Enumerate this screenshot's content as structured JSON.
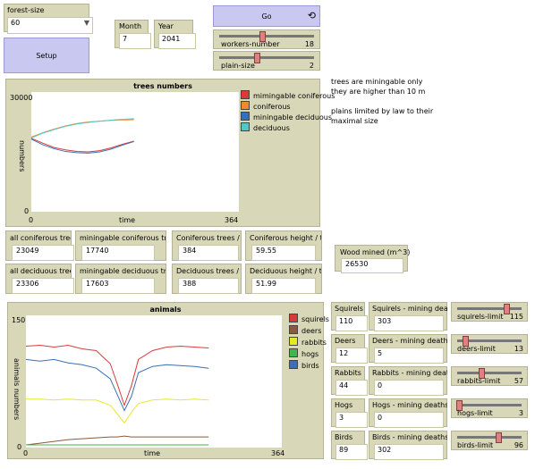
{
  "forest_size": {
    "label": "forest-size",
    "value": "60"
  },
  "month": {
    "label": "Month",
    "value": "7"
  },
  "year": {
    "label": "Year",
    "value": "2041"
  },
  "go_label": "Go",
  "setup_label": "Setup",
  "workers_slider": {
    "label": "workers-number",
    "value": "18",
    "level": 0.45
  },
  "plain_slider": {
    "label": "plain-size",
    "value": "2",
    "level": 0.4
  },
  "notes": [
    "trees are miningable only",
    "they are higher than 10 m",
    "",
    "plains limited by law to their",
    "maximal size"
  ],
  "trees_monitors": {
    "all_coniferous": {
      "label": "all coniferous trees",
      "value": "23049"
    },
    "mining_coniferous": {
      "label": "miningable coniferous trees",
      "value": "17740"
    },
    "coniferous_per_ha": {
      "label": "Coniferous trees / ha",
      "value": "384"
    },
    "coniferous_height": {
      "label": "Coniferous height / tile",
      "value": "59.55"
    },
    "all_deciduous": {
      "label": "all deciduous trees",
      "value": "23306"
    },
    "mining_deciduous": {
      "label": "miningable deciduous trees",
      "value": "17603"
    },
    "deciduous_per_ha": {
      "label": "Deciduous trees / ha",
      "value": "388"
    },
    "deciduous_height": {
      "label": "Deciduous height / tile",
      "value": "51.99"
    }
  },
  "wood_mined": {
    "label": "Wood mined (m^3)",
    "value": "26530"
  },
  "animal_rows": [
    {
      "count_label": "Squirels",
      "count_value": "110",
      "deaths_label": "Squirels - mining deaths",
      "deaths_value": "303",
      "limit_label": "squirels-limit",
      "limit_value": "115",
      "limit_level": 0.77
    },
    {
      "count_label": "Deers",
      "count_value": "12",
      "deaths_label": "Deers - mining deaths",
      "deaths_value": "5",
      "limit_label": "deers-limit",
      "limit_value": "13",
      "limit_level": 0.13
    },
    {
      "count_label": "Rabbits",
      "count_value": "44",
      "deaths_label": "Rabbits - mining deaths",
      "deaths_value": "0",
      "limit_label": "rabbits-limit",
      "limit_value": "57",
      "limit_level": 0.38
    },
    {
      "count_label": "Hogs",
      "count_value": "3",
      "deaths_label": "Hogs - mining deaths",
      "deaths_value": "0",
      "limit_label": "hogs-limit",
      "limit_value": "3",
      "limit_level": 0.03
    },
    {
      "count_label": "Birds",
      "count_value": "89",
      "deaths_label": "Birds - mining deaths",
      "deaths_value": "302",
      "limit_label": "birds-limit",
      "limit_value": "96",
      "limit_level": 0.64
    }
  ],
  "colors": {
    "accent_red": "#d73c3c",
    "accent_orange": "#f08a2a",
    "accent_blue": "#3a6fb5",
    "accent_cyan": "#4fc8c8",
    "accent_yellow": "#e8e82a",
    "accent_brown": "#8a5a3a",
    "accent_green": "#3cb84a"
  },
  "chart_data": [
    {
      "type": "line",
      "title": "trees numbers",
      "xlabel": "time",
      "ylabel": "numbers",
      "xlim": [
        0,
        364
      ],
      "ylim": [
        0,
        30000
      ],
      "x_ticks": [
        "0",
        "364"
      ],
      "y_ticks": [
        "0",
        "30000"
      ],
      "legend": "right",
      "x": [
        0,
        20,
        40,
        60,
        80,
        100,
        120,
        140,
        160,
        180
      ],
      "series": [
        {
          "name": "mimingable coniferous",
          "color": "#d73c3c",
          "values": [
            18400,
            17200,
            16100,
            15500,
            15100,
            15000,
            15300,
            16000,
            16900,
            17700
          ]
        },
        {
          "name": "coniferous",
          "color": "#f08a2a",
          "values": [
            18700,
            19800,
            20700,
            21500,
            22100,
            22500,
            22700,
            22900,
            23000,
            23050
          ]
        },
        {
          "name": "miningable deciduous",
          "color": "#3a6fb5",
          "values": [
            18200,
            16800,
            15800,
            15100,
            14800,
            14700,
            15000,
            15700,
            16700,
            17600
          ]
        },
        {
          "name": "deciduous",
          "color": "#4fc8c8",
          "values": [
            18500,
            19700,
            20600,
            21400,
            22000,
            22400,
            22700,
            22950,
            23150,
            23300
          ]
        }
      ]
    },
    {
      "type": "line",
      "title": "animals",
      "xlabel": "time",
      "ylabel": "animals numbers",
      "xlim": [
        0,
        364
      ],
      "ylim": [
        0,
        150
      ],
      "x_ticks": [
        "0",
        "364"
      ],
      "y_ticks": [
        "0",
        "150"
      ],
      "legend": "right",
      "x": [
        0,
        20,
        40,
        60,
        80,
        100,
        120,
        130,
        140,
        150,
        160,
        180,
        200,
        220,
        240,
        260
      ],
      "series": [
        {
          "name": "squirels",
          "color": "#d73c3c",
          "values": [
            115,
            116,
            114,
            116,
            112,
            110,
            95,
            72,
            48,
            70,
            100,
            110,
            114,
            115,
            114,
            113
          ]
        },
        {
          "name": "deers",
          "color": "#8a5a3a",
          "values": [
            3,
            5,
            7,
            9,
            10,
            11,
            12,
            12,
            13,
            12,
            12,
            12,
            12,
            12,
            12,
            12
          ]
        },
        {
          "name": "rabbits",
          "color": "#e8e82a",
          "values": [
            55,
            55,
            54,
            55,
            54,
            54,
            48,
            38,
            28,
            40,
            50,
            54,
            55,
            54,
            55,
            54
          ]
        },
        {
          "name": "hogs",
          "color": "#3cb84a",
          "values": [
            3,
            3,
            3,
            3,
            3,
            3,
            3,
            3,
            3,
            3,
            3,
            3,
            3,
            3,
            3,
            3
          ]
        },
        {
          "name": "birds",
          "color": "#3a6fb5",
          "values": [
            100,
            98,
            100,
            96,
            94,
            90,
            78,
            60,
            42,
            58,
            85,
            92,
            94,
            93,
            92,
            90
          ]
        }
      ]
    }
  ]
}
